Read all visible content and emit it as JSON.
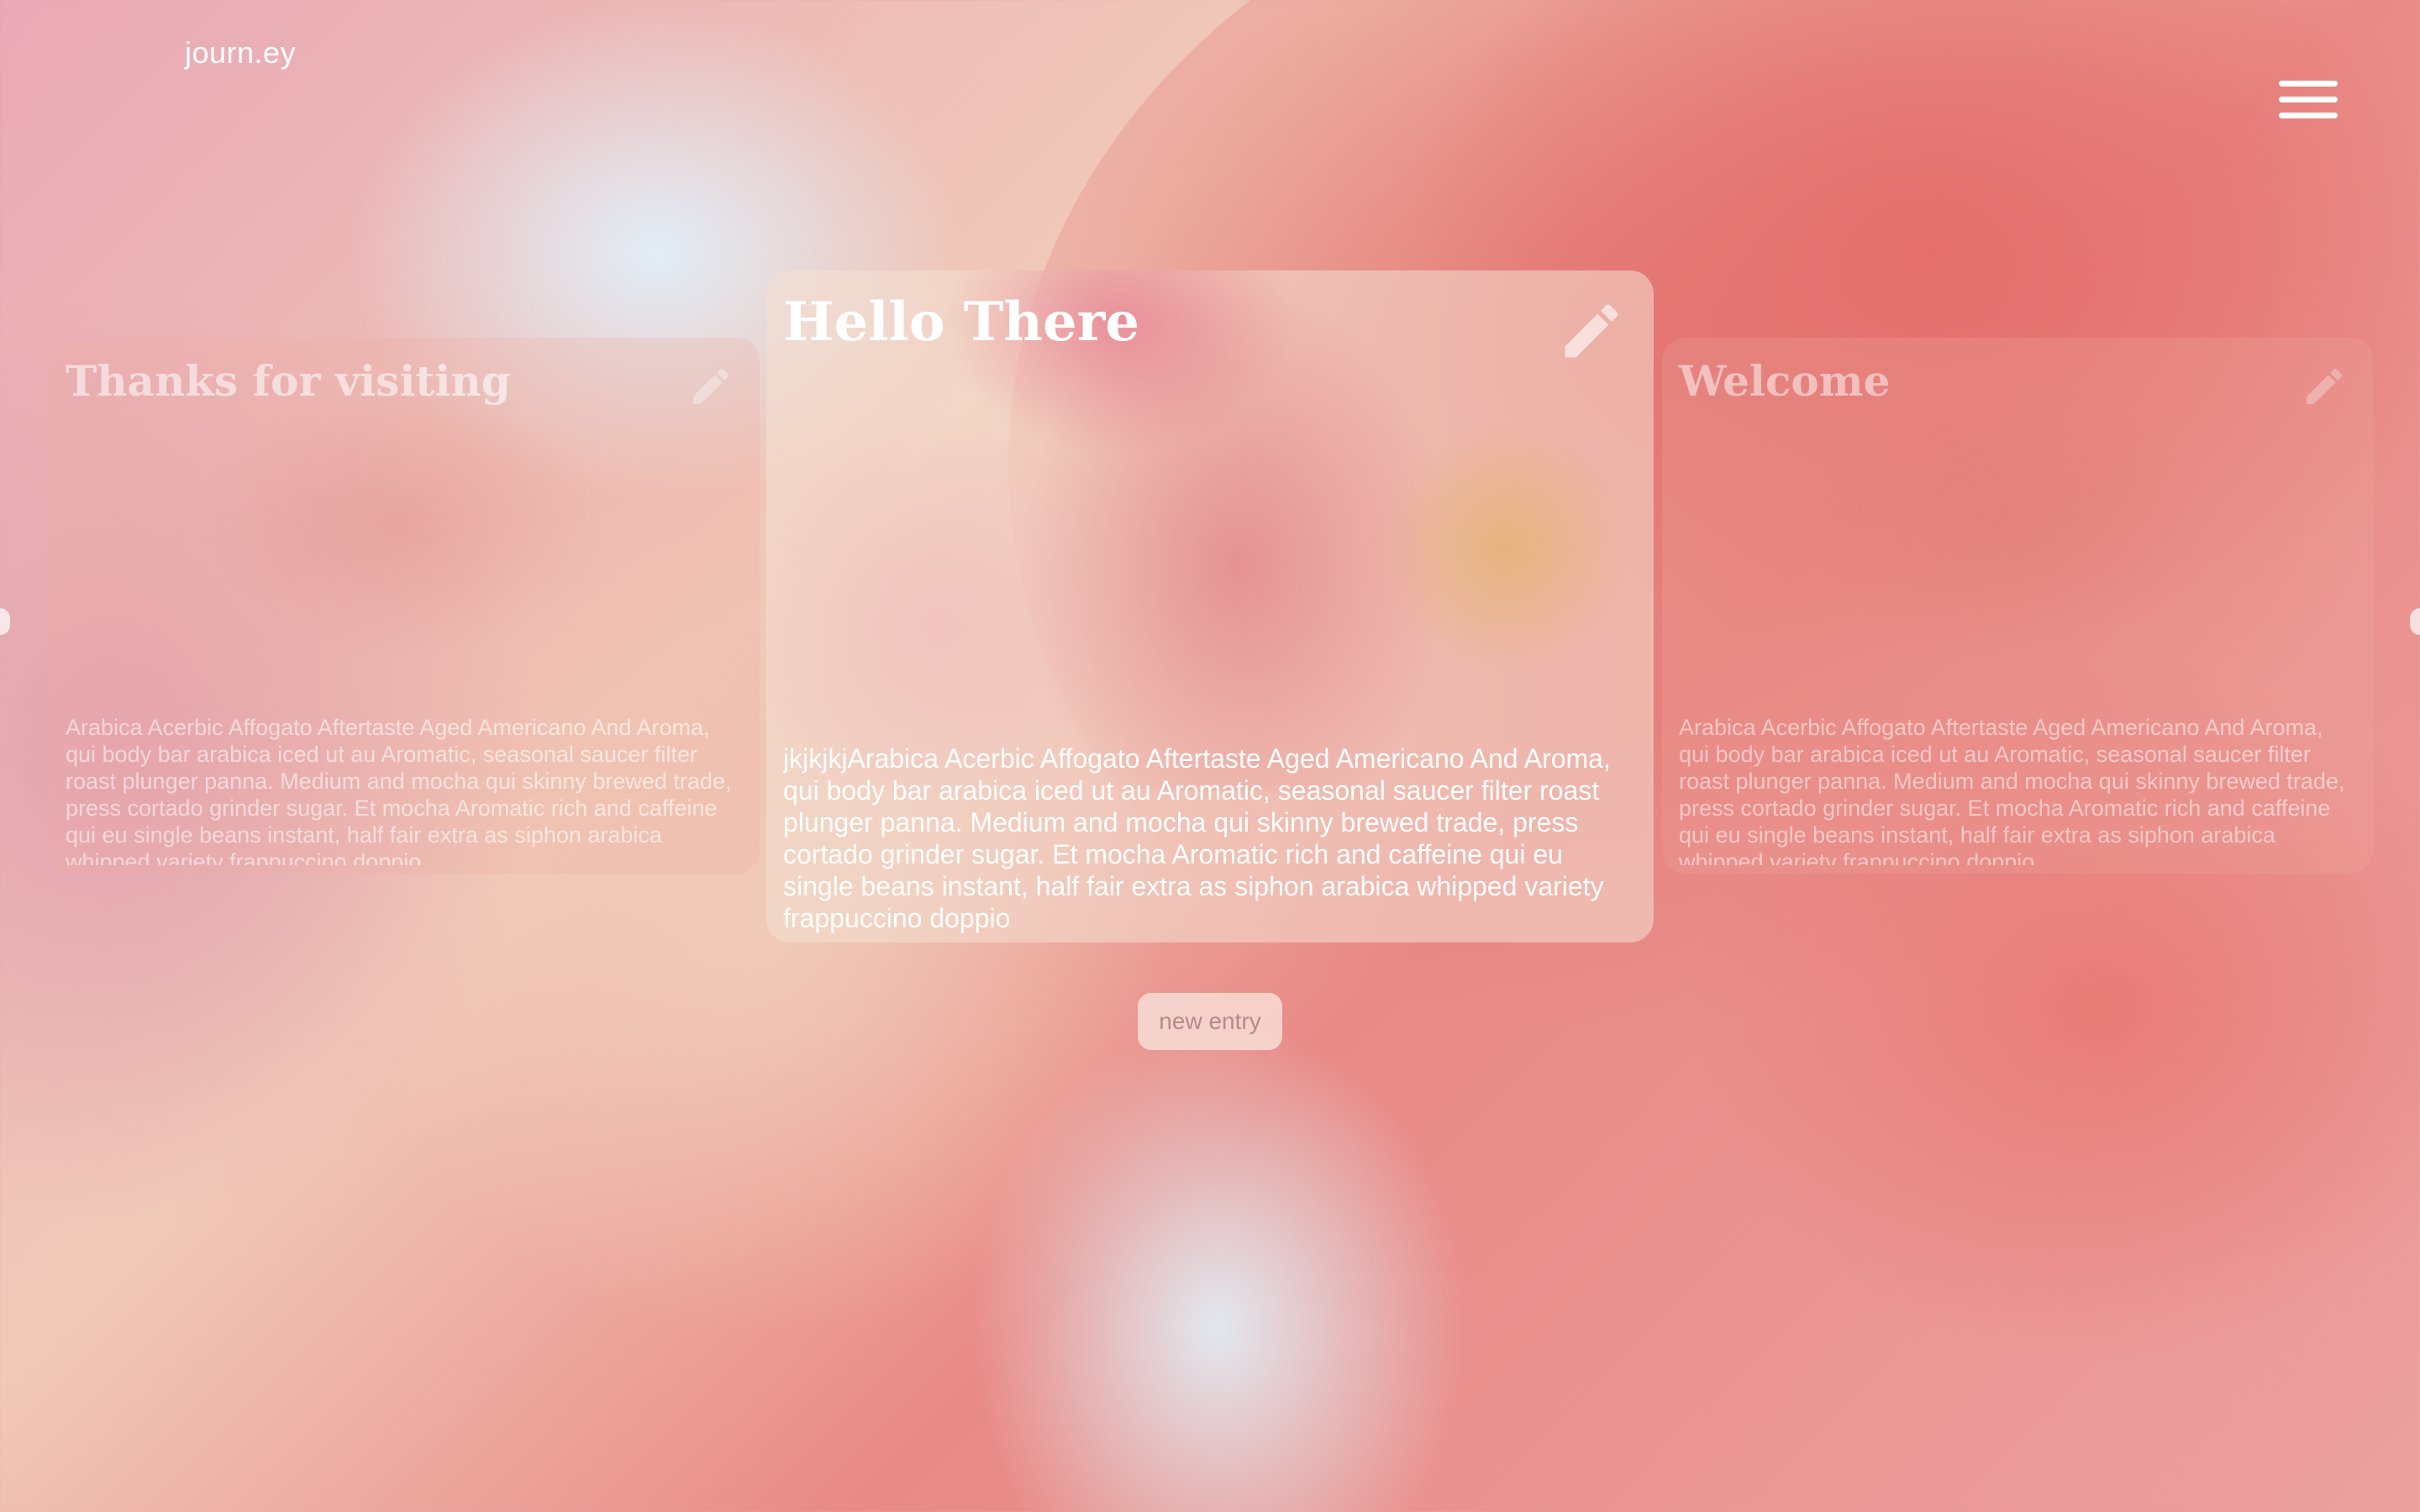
{
  "app": {
    "logo": "journ.ey"
  },
  "menu": {
    "icon": "hamburger-menu-icon"
  },
  "entries": {
    "center": {
      "title": "Hello There",
      "body": "jkjkjkjArabica Acerbic Affogato Aftertaste Aged Americano And Aroma, qui body bar arabica iced ut au Aromatic, seasonal saucer filter roast plunger panna. Medium and mocha qui skinny brewed trade, press cortado grinder sugar. Et mocha Aromatic rich and caffeine qui eu single beans instant, half fair extra as siphon arabica whipped variety frappuccino doppio",
      "edit_icon": "pencil-icon"
    },
    "left": {
      "title": "Thanks for visiting",
      "body": "Arabica Acerbic Affogato Aftertaste Aged Americano And Aroma, qui body bar arabica iced ut au Aromatic, seasonal saucer filter roast plunger panna. Medium and mocha qui skinny brewed trade, press cortado grinder sugar. Et mocha Aromatic rich and caffeine qui eu single beans instant, half fair extra as siphon arabica whipped variety frappuccino doppio",
      "edit_icon": "pencil-icon"
    },
    "right": {
      "title": "Welcome",
      "body": "Arabica Acerbic Affogato Aftertaste Aged Americano And Aroma, qui body bar arabica iced ut au Aromatic, seasonal saucer filter roast plunger panna. Medium and mocha qui skinny brewed trade, press cortado grinder sugar. Et mocha Aromatic rich and caffeine qui eu single beans instant, half fair extra as siphon arabica whipped variety frappuccino doppio",
      "edit_icon": "pencil-icon"
    }
  },
  "actions": {
    "new_entry_label": "new entry"
  },
  "colors": {
    "text": "#ffffff",
    "button_text": "#b58a88"
  }
}
